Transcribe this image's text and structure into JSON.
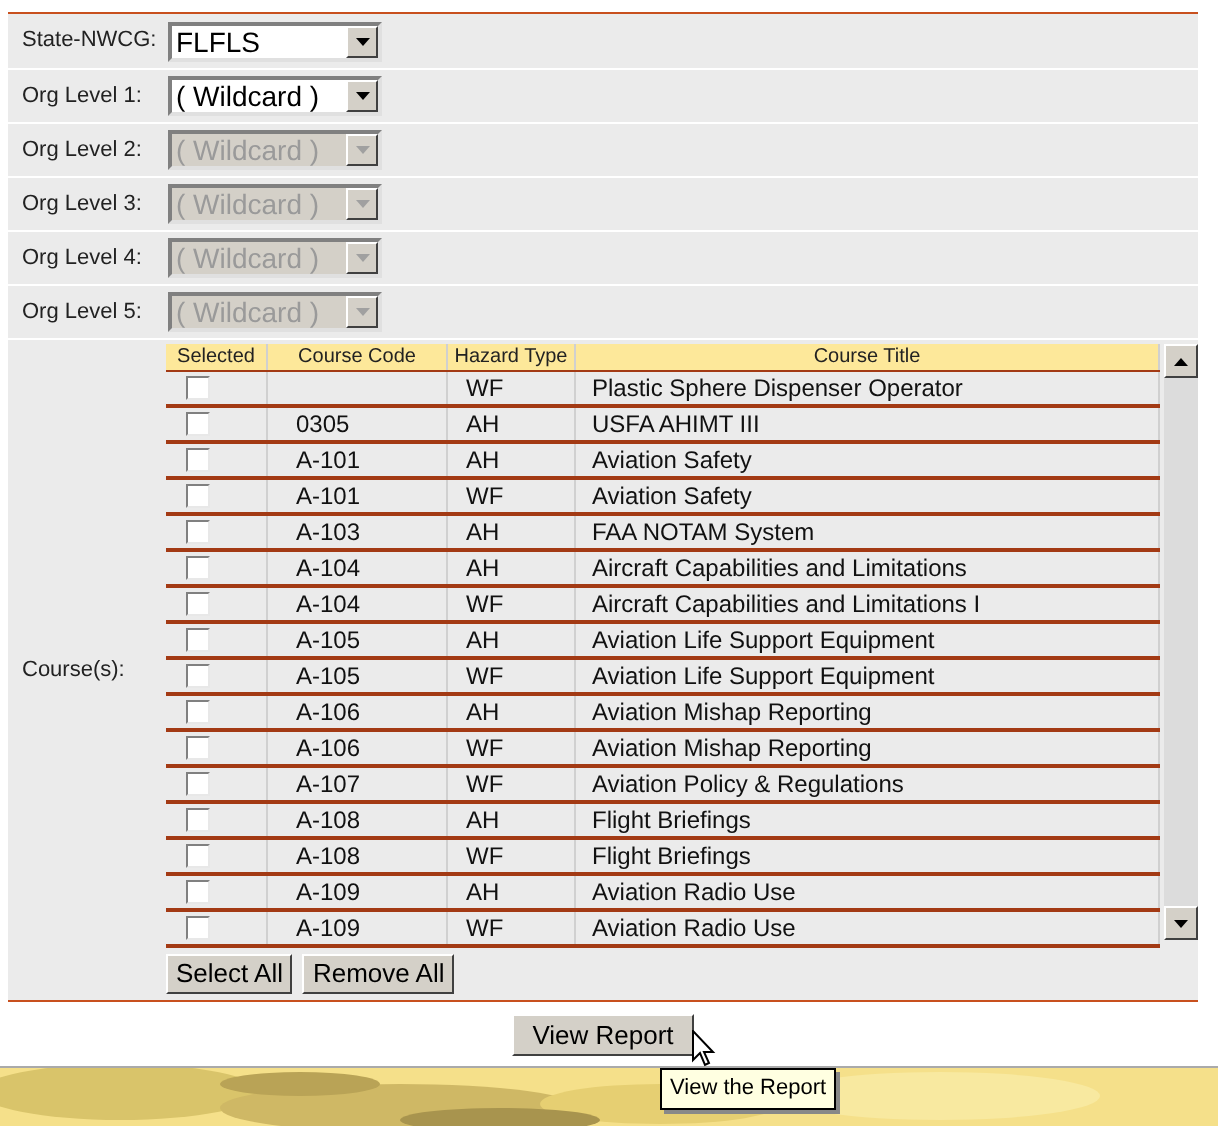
{
  "filters": [
    {
      "label": "State-NWCG:",
      "value": "FLFLS",
      "disabled": false
    },
    {
      "label": "Org Level 1:",
      "value": "( Wildcard )",
      "disabled": false
    },
    {
      "label": "Org Level 2:",
      "value": "( Wildcard )",
      "disabled": true
    },
    {
      "label": "Org Level 3:",
      "value": "( Wildcard )",
      "disabled": true
    },
    {
      "label": "Org Level 4:",
      "value": "( Wildcard )",
      "disabled": true
    },
    {
      "label": "Org Level 5:",
      "value": "( Wildcard )",
      "disabled": true
    }
  ],
  "courses": {
    "label": "Course(s):",
    "columns": [
      "Selected",
      "Course Code",
      "Hazard Type",
      "Course Title"
    ],
    "rows": [
      {
        "checked": false,
        "code": "",
        "hazard": "WF",
        "title": "Plastic Sphere Dispenser Operator"
      },
      {
        "checked": false,
        "code": "0305",
        "hazard": "AH",
        "title": "USFA AHIMT III"
      },
      {
        "checked": false,
        "code": "A-101",
        "hazard": "AH",
        "title": "Aviation Safety"
      },
      {
        "checked": false,
        "code": "A-101",
        "hazard": "WF",
        "title": "Aviation Safety"
      },
      {
        "checked": false,
        "code": "A-103",
        "hazard": "AH",
        "title": "FAA NOTAM System"
      },
      {
        "checked": false,
        "code": "A-104",
        "hazard": "AH",
        "title": "Aircraft Capabilities and Limitations"
      },
      {
        "checked": false,
        "code": "A-104",
        "hazard": "WF",
        "title": "Aircraft Capabilities and Limitations I"
      },
      {
        "checked": false,
        "code": "A-105",
        "hazard": "AH",
        "title": "Aviation Life Support Equipment"
      },
      {
        "checked": false,
        "code": "A-105",
        "hazard": "WF",
        "title": "Aviation Life Support Equipment"
      },
      {
        "checked": false,
        "code": "A-106",
        "hazard": "AH",
        "title": "Aviation Mishap Reporting"
      },
      {
        "checked": false,
        "code": "A-106",
        "hazard": "WF",
        "title": "Aviation Mishap Reporting"
      },
      {
        "checked": false,
        "code": "A-107",
        "hazard": "WF",
        "title": "Aviation Policy & Regulations"
      },
      {
        "checked": false,
        "code": "A-108",
        "hazard": "AH",
        "title": "Flight Briefings"
      },
      {
        "checked": false,
        "code": "A-108",
        "hazard": "WF",
        "title": "Flight Briefings"
      },
      {
        "checked": false,
        "code": "A-109",
        "hazard": "AH",
        "title": "Aviation Radio Use"
      },
      {
        "checked": false,
        "code": "A-109",
        "hazard": "WF",
        "title": "Aviation Radio Use"
      }
    ],
    "buttons": [
      "Select All",
      "Remove All"
    ]
  },
  "view_button": "View Report",
  "tooltip": "View the Report"
}
